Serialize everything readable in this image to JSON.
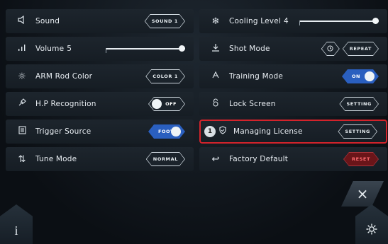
{
  "rows": [
    {
      "left": {
        "icon": "speaker-icon",
        "label": "Sound",
        "button": "SOUND 1"
      },
      "right": {
        "icon": "snowflake-icon",
        "label": "Cooling Level",
        "value": "4",
        "slider_fraction": 1.0
      }
    },
    {
      "left": {
        "icon": "volume-bars-icon",
        "label": "Volume",
        "value": "5",
        "slider_fraction": 1.0
      },
      "right": {
        "icon": "download-arrow-icon",
        "label": "Shot Mode",
        "button": "REPEAT"
      }
    },
    {
      "left": {
        "icon": "sun-icon",
        "label": "ARM Rod Color",
        "button": "COLOR 1"
      },
      "right": {
        "icon": "training-icon",
        "label": "Training Mode",
        "toggle": "ON"
      }
    },
    {
      "left": {
        "icon": "probe-icon",
        "label": "H.P Recognition",
        "toggle": "OFF"
      },
      "right": {
        "icon": "lock-icon",
        "label": "Lock Screen",
        "button": "SETTING"
      }
    },
    {
      "left": {
        "icon": "document-icon",
        "label": "Trigger Source",
        "toggle": "FOOT"
      },
      "right": {
        "icon": "shield-check-icon",
        "label": "Managing License",
        "button": "SETTING",
        "badge": "1"
      }
    },
    {
      "left": {
        "icon": "up-down-arrows-icon",
        "label": "Tune Mode",
        "button": "NORMAL"
      },
      "right": {
        "icon": "return-arrow-icon",
        "label": "Factory Default",
        "button": "RESET"
      }
    }
  ],
  "bottom": {
    "info_label": "i",
    "close_label": "×",
    "settings_icon": "gear-icon"
  },
  "colors": {
    "highlight": "#d3232b",
    "toggle_on": "#2a5fbf",
    "reset": "#a9333a"
  }
}
